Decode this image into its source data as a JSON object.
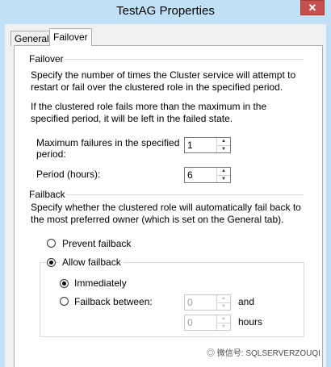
{
  "window": {
    "title": "TestAG Properties",
    "close_icon": "close-icon"
  },
  "tabs": [
    {
      "label": "General"
    },
    {
      "label": "Failover"
    }
  ],
  "failover": {
    "heading": "Failover",
    "desc1": "Specify the number of times the Cluster service will attempt to restart or fail over the clustered role in the specified period.",
    "desc2": "If the clustered role fails more than the maximum in the specified period, it will be left in the failed state.",
    "max_failures_label": "Maximum failures in the specified period:",
    "max_failures_value": "1",
    "period_label": "Period (hours):",
    "period_value": "6"
  },
  "failback": {
    "heading": "Failback",
    "desc": "Specify whether the clustered role will automatically fail back to the most preferred owner (which is set on the General tab).",
    "prevent_label": "Prevent failback",
    "allow_label": "Allow failback",
    "immediately_label": "Immediately",
    "between_label": "Failback between:",
    "between_start": "0",
    "between_end": "0",
    "and_label": "and",
    "hours_label": "hours",
    "selected": "allow",
    "allow_mode": "immediately"
  },
  "watermark": {
    "text": "微信号: SQLSERVERZOUQI"
  }
}
